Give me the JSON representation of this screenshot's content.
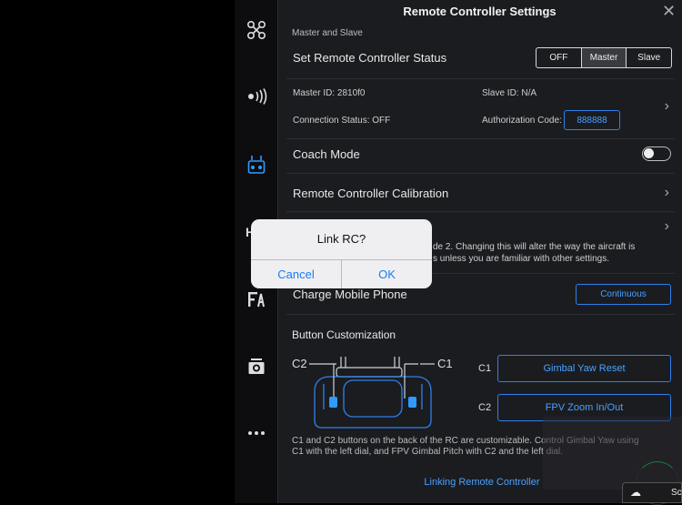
{
  "panel": {
    "title": "Remote Controller Settings",
    "close_icon": "close-icon",
    "section_master_slave": "Master and Slave",
    "set_status_label": "Set Remote Controller Status",
    "status_options": [
      "OFF",
      "Master",
      "Slave"
    ],
    "status_selected": "Master",
    "master_id": "Master ID: 2810f0",
    "slave_id": "Slave ID: N/A",
    "connection_status": "Connection Status: OFF",
    "auth_code_label": "Authorization Code:",
    "auth_code_value": "888888",
    "coach_mode": "Coach Mode",
    "calibration": "Remote Controller Calibration",
    "stick_mode_desc_1": "de 2. Changing this will alter the way the aircraft is",
    "stick_mode_desc_2": "s unless you are familiar with other settings.",
    "charge_mobile": "Charge Mobile Phone",
    "charge_value": "Continuous",
    "button_custom": "Button Customization",
    "c1": "C1",
    "c2": "C2",
    "c1_value": "Gimbal Yaw Reset",
    "c2_value": "FPV Zoom In/Out",
    "custom_desc_1": "C1 and C2 buttons on the back of the RC are customizable. Control Gimbal Yaw using",
    "custom_desc_2": "C1 with the left dial, and FPV Gimbal Pitch with C2 and the left dial.",
    "linking": "Linking Remote Controller"
  },
  "rail": {
    "icons": [
      "aircraft-icon",
      "signal-icon",
      "remote-controller-icon",
      "hd-icon",
      "transmission-icon",
      "camera-icon",
      "more-icon"
    ],
    "hd_partial": "H"
  },
  "dialog": {
    "title": "Link RC?",
    "cancel": "Cancel",
    "ok": "OK"
  },
  "corner": {
    "text": "Sc"
  },
  "colors": {
    "accent": "#2f80ed",
    "dialog_button": "#1b7cf5",
    "panel_bg": "#1b1c1f"
  }
}
